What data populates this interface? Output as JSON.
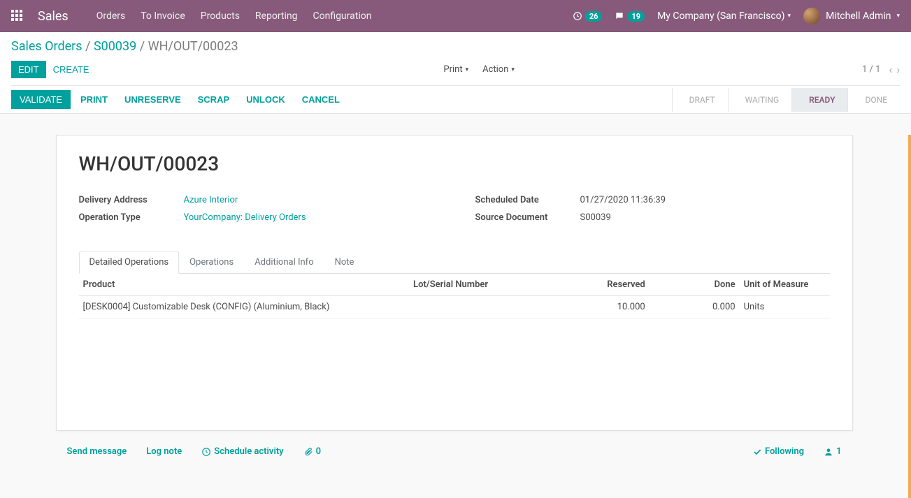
{
  "navbar": {
    "brand": "Sales",
    "links": [
      "Orders",
      "To Invoice",
      "Products",
      "Reporting",
      "Configuration"
    ],
    "timer_count": "26",
    "chat_count": "19",
    "company": "My Company (San Francisco)",
    "user": "Mitchell Admin"
  },
  "breadcrumb": {
    "root": "Sales Orders",
    "parent": "S00039",
    "current": "WH/OUT/00023"
  },
  "buttons": {
    "edit": "EDIT",
    "create": "CREATE",
    "print": "Print",
    "action": "Action",
    "validate": "VALIDATE",
    "print2": "PRINT",
    "unreserve": "UNRESERVE",
    "scrap": "SCRAP",
    "unlock": "UNLOCK",
    "cancel": "CANCEL"
  },
  "pager": "1 / 1",
  "stages": {
    "draft": "DRAFT",
    "waiting": "WAITING",
    "ready": "READY",
    "done": "DONE"
  },
  "record": {
    "title": "WH/OUT/00023",
    "labels": {
      "delivery_address": "Delivery Address",
      "operation_type": "Operation Type",
      "scheduled_date": "Scheduled Date",
      "source_document": "Source Document"
    },
    "delivery_address": "Azure Interior",
    "operation_type": "YourCompany: Delivery Orders",
    "scheduled_date": "01/27/2020 11:36:39",
    "source_document": "S00039"
  },
  "tabs": [
    "Detailed Operations",
    "Operations",
    "Additional Info",
    "Note"
  ],
  "table": {
    "headers": {
      "product": "Product",
      "lot": "Lot/Serial Number",
      "reserved": "Reserved",
      "done": "Done",
      "uom": "Unit of Measure"
    },
    "rows": [
      {
        "product": "[DESK0004] Customizable Desk (CONFIG) (Aluminium, Black)",
        "lot": "",
        "reserved": "10.000",
        "done": "0.000",
        "uom": "Units"
      }
    ]
  },
  "chatter": {
    "send": "Send message",
    "log": "Log note",
    "schedule": "Schedule activity",
    "attachments": "0",
    "following": "Following",
    "followers": "1"
  }
}
